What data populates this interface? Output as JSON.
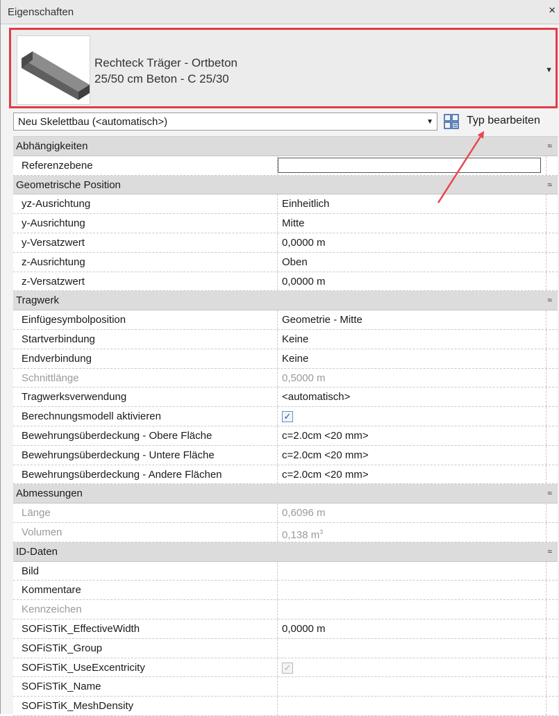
{
  "window": {
    "title": "Eigenschaften",
    "close": "×"
  },
  "type_selector": {
    "line1": "Rechteck Träger - Ortbeton",
    "line2": "25/50 cm Beton - C 25/30",
    "caret": "▼",
    "highlight_color": "#e03c46"
  },
  "instance_filter": {
    "value": "Neu Skelettbau (<automatisch>)",
    "caret": "▼"
  },
  "edit_type": {
    "label": "Typ bearbeiten",
    "icon": "edit-type-icon"
  },
  "groups": {
    "abh": {
      "label": "Abhängigkeiten",
      "toggle": "≈"
    },
    "geo": {
      "label": "Geometrische Position",
      "toggle": "≈"
    },
    "trag": {
      "label": "Tragwerk",
      "toggle": "≈"
    },
    "abm": {
      "label": "Abmessungen",
      "toggle": "≈"
    },
    "id": {
      "label": "ID-Daten",
      "toggle": "≈"
    }
  },
  "props": {
    "referenzebene": {
      "name": "Referenzebene",
      "value": ""
    },
    "yz_ausrichtung": {
      "name": "yz-Ausrichtung",
      "value": "Einheitlich"
    },
    "y_ausrichtung": {
      "name": "y-Ausrichtung",
      "value": "Mitte"
    },
    "y_versatz": {
      "name": "y-Versatzwert",
      "value": "0,0000 m"
    },
    "z_ausrichtung": {
      "name": "z-Ausrichtung",
      "value": "Oben"
    },
    "z_versatz": {
      "name": "z-Versatzwert",
      "value": "0,0000 m"
    },
    "einfuege": {
      "name": "Einfügesymbolposition",
      "value": "Geometrie - Mitte"
    },
    "startverb": {
      "name": "Startverbindung",
      "value": "Keine"
    },
    "endverb": {
      "name": "Endverbindung",
      "value": "Keine"
    },
    "schnittlaenge": {
      "name": "Schnittlänge",
      "value": "0,5000 m"
    },
    "tragwerksverw": {
      "name": "Tragwerksverwendung",
      "value": "<automatisch>"
    },
    "berechnung": {
      "name": "Berechnungsmodell aktivieren",
      "checked": true
    },
    "bew_oben": {
      "name": "Bewehrungsüberdeckung - Obere Fläche",
      "value": "c=2.0cm <20 mm>"
    },
    "bew_unten": {
      "name": "Bewehrungsüberdeckung - Untere Fläche",
      "value": "c=2.0cm <20 mm>"
    },
    "bew_andere": {
      "name": "Bewehrungsüberdeckung - Andere Flächen",
      "value": "c=2.0cm <20 mm>"
    },
    "laenge": {
      "name": "Länge",
      "value": "0,6096 m"
    },
    "volumen": {
      "name": "Volumen",
      "value": "0,138 m",
      "unit_sup": "3"
    },
    "bild": {
      "name": "Bild",
      "value": ""
    },
    "kommentare": {
      "name": "Kommentare",
      "value": ""
    },
    "kennzeichen": {
      "name": "Kennzeichen",
      "value": ""
    },
    "eff_width": {
      "name": "SOFiSTiK_EffectiveWidth",
      "value": "0,0000 m"
    },
    "group": {
      "name": "SOFiSTiK_Group",
      "value": ""
    },
    "use_exc": {
      "name": "SOFiSTiK_UseExcentricity",
      "checked": true
    },
    "sof_name": {
      "name": "SOFiSTiK_Name",
      "value": ""
    },
    "mesh": {
      "name": "SOFiSTiK_MeshDensity",
      "value": ""
    }
  },
  "checkmark": "✓"
}
